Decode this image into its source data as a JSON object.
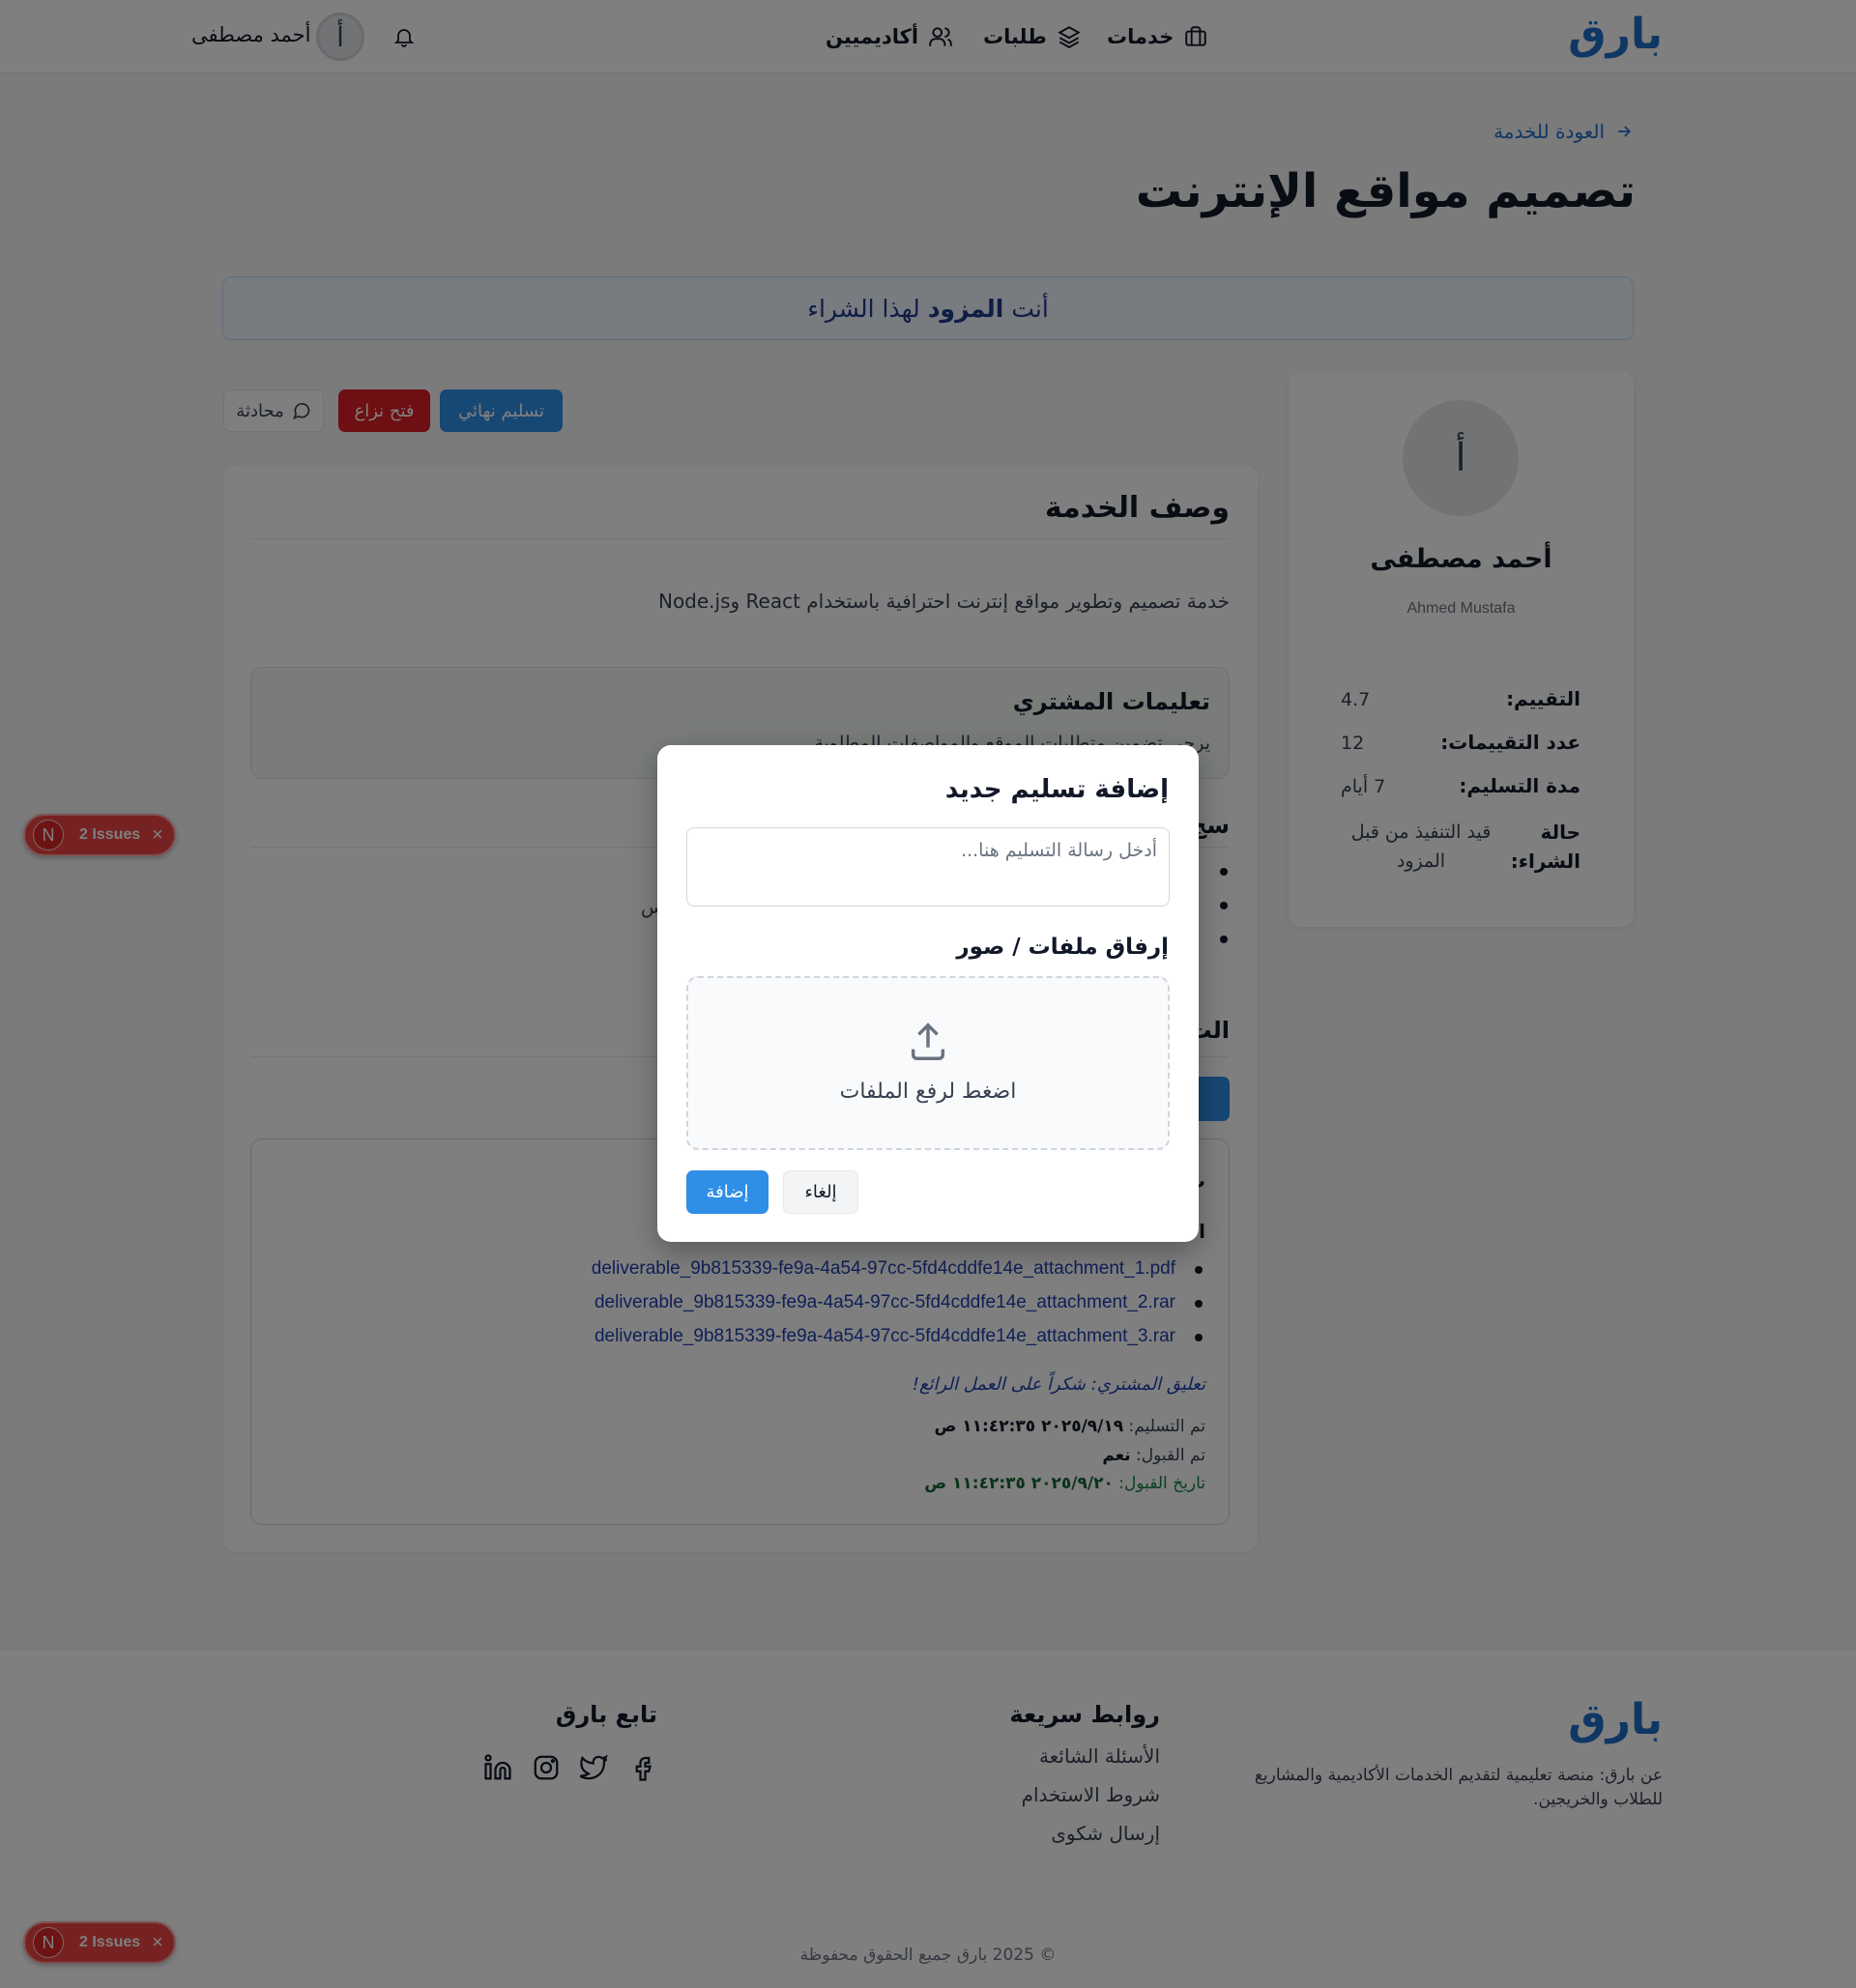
{
  "header": {
    "logo": "بارق",
    "nav": [
      {
        "label": "خدمات",
        "icon": "briefcase-icon"
      },
      {
        "label": "طلبات",
        "icon": "layers-icon"
      },
      {
        "label": "أكاديميين",
        "icon": "users-icon"
      }
    ],
    "user_name": "أحمد مصطفى",
    "avatar_letter": "أ",
    "bell_icon": "bell-icon"
  },
  "page": {
    "back_link": "العودة للخدمة",
    "title": "تصميم مواقع الإنترنت"
  },
  "role_banner": {
    "prefix": "أنت",
    "role": "المزود",
    "suffix": "لهذا الشراء"
  },
  "actions": {
    "final_delivery": "تسليم نهائي",
    "open_dispute": "فتح نزاع",
    "chat": "محادثة"
  },
  "provider": {
    "avatar_letter": "أ",
    "name": "أحمد مصطفى",
    "name_en": "Ahmed Mustafa",
    "stats": [
      {
        "label": "التقييم:",
        "value": "4.7"
      },
      {
        "label": "عدد التقييمات:",
        "value": "12"
      },
      {
        "label": "مدة التسليم:",
        "value": "7 أيام"
      },
      {
        "label": "حالة الشراء:",
        "value": "قيد التنفيذ من قبل المزود"
      }
    ]
  },
  "description": {
    "title": "وصف الخدمة",
    "text": "خدمة تصميم وتطوير مواقع إنترنت احترافية باستخدام React وNode.js",
    "instructions_title": "تعليمات المشتري",
    "instructions_text": "يرجى تضمين متطلبات الموقع والمواصفات المطلوبة",
    "log_title_partial": "سج",
    "log_fragment": "س",
    "deliveries_title_partial": "الت",
    "add_delivery_partial": "إ"
  },
  "delivery": {
    "heading_partial_1": "ت",
    "heading_partial_2": "ا",
    "attachments": [
      "deliverable_9b815339-fe9a-4a54-97cc-5fd4cddfe14e_attachment_1.pdf",
      "deliverable_9b815339-fe9a-4a54-97cc-5fd4cddfe14e_attachment_2.rar",
      "deliverable_9b815339-fe9a-4a54-97cc-5fd4cddfe14e_attachment_3.rar"
    ],
    "buyer_comment": "تعليق المشتري: شكراً على العمل الرائع!",
    "delivered_label": "تم التسليم:",
    "delivered_value": "٢٠٢٥/٩/١٩ ١١:٤٢:٣٥ ص",
    "accepted_label": "تم القبول:",
    "accepted_value": "نعم",
    "accept_date_label": "تاريخ القبول:",
    "accept_date_value": "٢٠٢٥/٩/٢٠ ١١:٤٢:٣٥ ص"
  },
  "modal": {
    "title": "إضافة تسليم جديد",
    "message_placeholder": "أدخل رسالة التسليم هنا...",
    "attach_title": "إرفاق ملفات / صور",
    "dropzone_text": "اضغط لرفع الملفات",
    "add_button": "إضافة",
    "cancel_button": "إلغاء"
  },
  "footer": {
    "logo": "بارق",
    "about": "عن بارق: منصة تعليمية لتقديم الخدمات الأكاديمية والمشاريع للطلاب والخريجين.",
    "quick_links_title": "روابط سريعة",
    "quick_links": [
      "الأسئلة الشائعة",
      "شروط الاستخدام",
      "إرسال شكوى"
    ],
    "follow_title": "تابع بارق",
    "social_icons": [
      "facebook-icon",
      "twitter-icon",
      "instagram-icon",
      "linkedin-icon"
    ],
    "copyright": "© 2025 بارق جميع الحقوق محفوظة"
  },
  "issues_badge": {
    "letter": "N",
    "label": "2 Issues",
    "close": "×"
  },
  "colors": {
    "brand": "#1e6fc9",
    "primary_button": "#2f8ee6",
    "danger_button": "#dc1f26",
    "success_text": "#15803d",
    "overlay": "rgba(0,0,0,0.5)"
  }
}
